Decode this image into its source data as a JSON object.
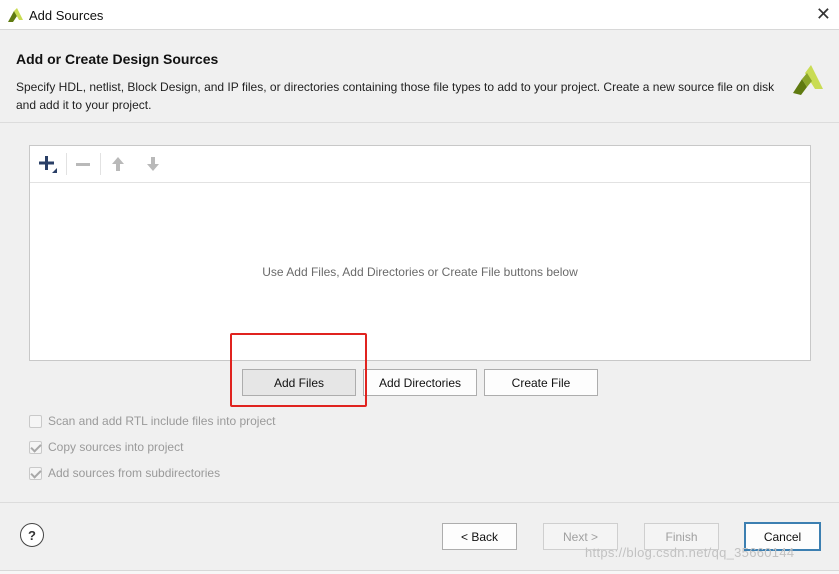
{
  "window": {
    "title": "Add Sources",
    "close_label": "✕"
  },
  "header": {
    "title": "Add or Create Design Sources",
    "description": "Specify HDL, netlist, Block Design, and IP files, or directories containing those file types to add to your project. Create a new source file on disk and add it to your project."
  },
  "panel": {
    "empty_message": "Use Add Files, Add Directories or Create File buttons below",
    "toolbar_icons": [
      "plus-icon",
      "minus-icon",
      "arrow-up-icon",
      "arrow-down-icon"
    ]
  },
  "buttons": {
    "add_files": "Add Files",
    "add_directories": "Add Directories",
    "create_file": "Create File"
  },
  "options": [
    {
      "label": "Scan and add RTL include files into project",
      "checked": false
    },
    {
      "label": "Copy sources into project",
      "checked": true
    },
    {
      "label": "Add sources from subdirectories",
      "checked": true
    }
  ],
  "footer": {
    "help": "?",
    "back": "< Back",
    "next": "Next >",
    "finish": "Finish",
    "cancel": "Cancel",
    "watermark": "https://blog.csdn.net/qq_35660144"
  },
  "colors": {
    "highlight": "#e0231f",
    "primary_border": "#3c7fb1",
    "brand_dark": "#5f7a10",
    "brand_light": "#c9dc54"
  }
}
